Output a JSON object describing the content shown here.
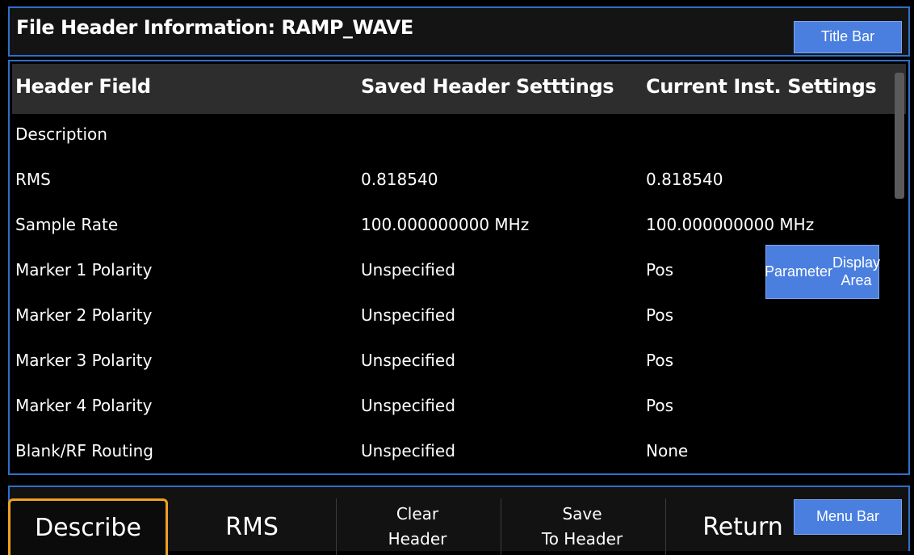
{
  "title_bar": {
    "title": "File Header Information: RAMP_WAVE",
    "callout": "Title Bar"
  },
  "table": {
    "headers": [
      "Header Field",
      "Saved Header Setttings",
      "Current Inst. Settings"
    ],
    "rows": [
      [
        "Description",
        "",
        ""
      ],
      [
        "RMS",
        "0.818540",
        "0.818540"
      ],
      [
        "Sample Rate",
        "100.000000000 MHz",
        "100.000000000 MHz"
      ],
      [
        "Marker 1 Polarity",
        "Unspecified",
        "Pos"
      ],
      [
        "Marker 2 Polarity",
        "Unspecified",
        "Pos"
      ],
      [
        "Marker 3 Polarity",
        "Unspecified",
        "Pos"
      ],
      [
        "Marker 4 Polarity",
        "Unspecified",
        "Pos"
      ],
      [
        "Blank/RF Routing",
        "Unspecified",
        "None"
      ]
    ],
    "callout_line1": "Parameter",
    "callout_line2": "Display Area"
  },
  "menu_bar": {
    "keys": [
      {
        "line1": "Describe"
      },
      {
        "line1": "RMS"
      },
      {
        "line1": "Clear",
        "line2": "Header"
      },
      {
        "line1": "Save",
        "line2": "To Header"
      },
      {
        "line1": "Return"
      }
    ],
    "callout": "Menu Bar"
  },
  "colors": {
    "region_border": "#2f6fc8",
    "callout_bg": "#4a7fe0",
    "selected_key_border": "#f0a020",
    "header_row_bg": "#2d2d2d"
  }
}
